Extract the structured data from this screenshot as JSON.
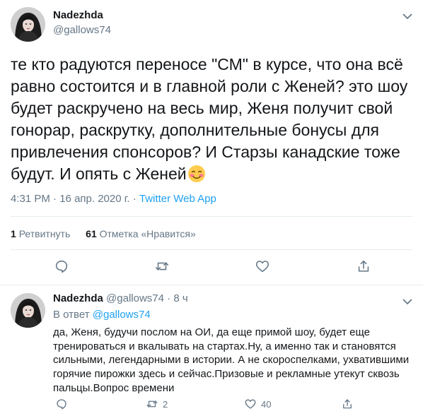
{
  "main_tweet": {
    "author_name": "Nadezhda",
    "author_handle": "@gallows74",
    "text": "те кто радуются переносе \"СМ\" в курсе, что она всё равно состоится и в главной роли с Женей? это шоу будет раскручено на весь мир, Женя получит свой гонорар, раскрутку, дополнительные бонусы для привлечения спонсоров? И Старзы канадские тоже будут. И  опять с Женей",
    "emoji": "smiling-face-with-blush",
    "time": "4:31 PM",
    "date": "16 апр. 2020 г.",
    "separator": "·",
    "client": "Twitter Web App",
    "retweets_count": "1",
    "retweets_label": "Ретвитнуть",
    "likes_count": "61",
    "likes_label": "Отметка «Нравится»"
  },
  "reply_tweet": {
    "author_name": "Nadezhda",
    "author_handle": "@gallows74",
    "time_ago": "8 ч",
    "separator": "·",
    "reply_prefix": "В ответ",
    "reply_to_handle": "@gallows74",
    "text": "да, Женя, будучи послом на ОИ, да еще примой шоу, будет еще тренироваться и вкалывать на стартах.Ну, а именно так и становятся сильными, легендарными в истории. А не скороспелками, ухватившими горячие пирожки здесь и сейчас.Призовые и рекламные утекут сквозь пальцы.Вопрос времени",
    "retweets_count": "2",
    "likes_count": "40"
  },
  "colors": {
    "text": "#14171a",
    "secondary": "#657786",
    "link": "#1da1f2",
    "divider": "#e6ecf0"
  }
}
